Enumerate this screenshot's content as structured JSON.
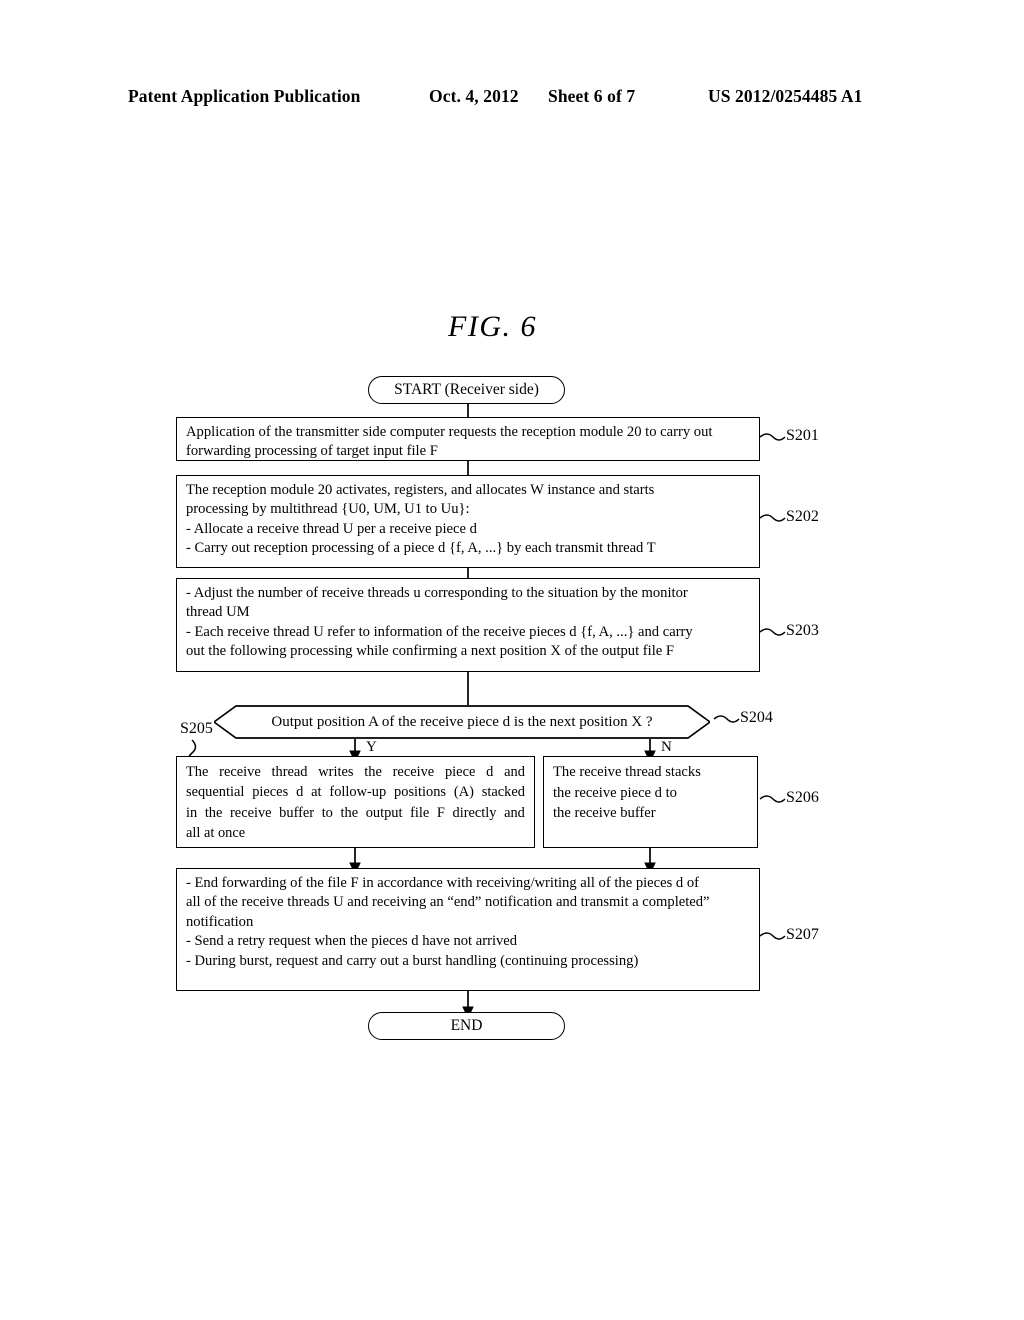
{
  "header": {
    "title": "Patent Application Publication",
    "date": "Oct. 4, 2012",
    "sheet": "Sheet 6 of 7",
    "number": "US 2012/0254485 A1"
  },
  "figure": {
    "title": "FIG.  6"
  },
  "flowchart": {
    "start": {
      "label": "START (Receiver side)"
    },
    "end": {
      "label": "END"
    },
    "branch_yes": "Y",
    "branch_no": "N",
    "steps": {
      "s201": {
        "id": "S201",
        "lines": [
          "Application of the transmitter side computer requests the reception module 20 to carry out",
          "forwarding processing of target input file F"
        ]
      },
      "s202": {
        "id": "S202",
        "lines": [
          "The reception module 20 activates, registers, and allocates W instance and starts",
          "processing by multithread {U0, UM, U1 to Uu}:",
          "- Allocate a receive thread U per a receive piece d",
          "- Carry out reception processing of a piece d {f, A, ...} by each transmit thread T"
        ]
      },
      "s203": {
        "id": "S203",
        "lines": [
          "- Adjust the number of receive threads u corresponding to the situation by the monitor",
          "thread UM",
          "- Each receive thread U refer to information of the receive pieces d {f, A, ...} and carry",
          "out the following processing while confirming a next position X of the output file F"
        ]
      },
      "s204": {
        "id": "S204",
        "label": "Output position A of the receive piece d is the next position X ?"
      },
      "s205": {
        "id": "S205",
        "lines": [
          [
            "The",
            "receive",
            "thread",
            "writes",
            "the",
            "receive",
            "piece",
            "d",
            "and"
          ],
          [
            "sequential",
            "pieces",
            "d",
            "at",
            "follow-up",
            "positions",
            "(A)",
            "stacked"
          ],
          [
            "in",
            "the",
            "receive",
            "buffer",
            "to",
            "the",
            "output",
            "file",
            "F",
            "directly",
            "and"
          ],
          [
            "all at once"
          ]
        ]
      },
      "s206": {
        "id": "S206",
        "lines": [
          "The receive thread stacks",
          "the receive piece d to",
          "the receive buffer"
        ]
      },
      "s207": {
        "id": "S207",
        "lines": [
          "- End forwarding of the file F in accordance with receiving/writing all of the pieces d of",
          "all of the receive threads U and receiving an “end” notification and transmit a completed”",
          "notification",
          "- Send a retry request when the pieces d have not arrived",
          "- During burst, request and carry out a burst handling (continuing processing)"
        ]
      }
    }
  }
}
